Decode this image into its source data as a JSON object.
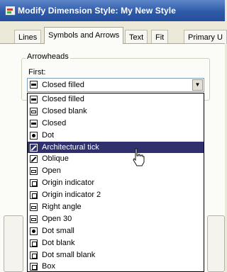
{
  "window": {
    "title": "Modify Dimension Style: My New Style"
  },
  "tabs": [
    {
      "label": "Lines"
    },
    {
      "label": "Symbols and Arrows"
    },
    {
      "label": "Text"
    },
    {
      "label": "Fit"
    },
    {
      "label": "Primary U"
    }
  ],
  "arrowheads": {
    "group_label": "Arrowheads",
    "first_label": "First:",
    "selected_value": "Closed filled",
    "options": [
      {
        "label": "Closed filled",
        "icon": "closed-filled-icon"
      },
      {
        "label": "Closed blank",
        "icon": "closed-blank-icon"
      },
      {
        "label": "Closed",
        "icon": "closed-icon"
      },
      {
        "label": "Dot",
        "icon": "dot-icon"
      },
      {
        "label": "Architectural tick",
        "icon": "architectural-tick-icon",
        "selected": true
      },
      {
        "label": "Oblique",
        "icon": "oblique-icon"
      },
      {
        "label": "Open",
        "icon": "open-icon"
      },
      {
        "label": "Origin indicator",
        "icon": "origin-indicator-icon"
      },
      {
        "label": "Origin indicator 2",
        "icon": "origin-indicator-2-icon"
      },
      {
        "label": "Right angle",
        "icon": "right-angle-icon"
      },
      {
        "label": "Open 30",
        "icon": "open-30-icon"
      },
      {
        "label": "Dot small",
        "icon": "dot-small-icon"
      },
      {
        "label": "Dot blank",
        "icon": "dot-blank-icon"
      },
      {
        "label": "Dot small blank",
        "icon": "dot-small-blank-icon"
      },
      {
        "label": "Box",
        "icon": "box-icon"
      }
    ]
  },
  "colors": {
    "title_bar": "#2f5aa8",
    "selection": "#30306f",
    "panel": "#fbfbf8"
  }
}
